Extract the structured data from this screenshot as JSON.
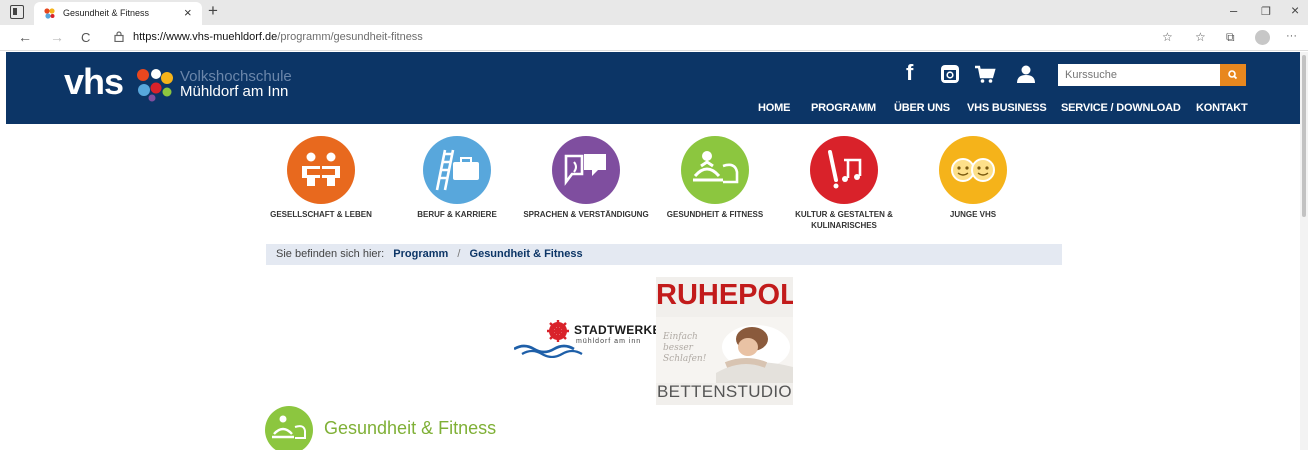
{
  "browser": {
    "tab_title": "Gesundheit & Fitness",
    "tab_close": "×",
    "new_tab": "+",
    "url_host": "https://www.vhs-muehldorf.de",
    "url_path": "/programm/gesundheit-fitness",
    "nav": {
      "back": "←",
      "forward": "→",
      "reload": "C"
    },
    "window": {
      "minimize": "–",
      "restore": "❐",
      "close": "×"
    },
    "tools": {
      "favorites_add": "☆",
      "favorites": "☆",
      "collections": "⧉",
      "more": "···"
    }
  },
  "header": {
    "logo_vhs": "vhs",
    "logo_line1": "Volkshochschule",
    "logo_line2": "Mühldorf am Inn",
    "social": {
      "facebook": "f"
    },
    "search_placeholder": "Kurssuche",
    "nav": [
      {
        "label": "HOME"
      },
      {
        "label": "PROGRAMM"
      },
      {
        "label": "ÜBER UNS"
      },
      {
        "label": "VHS BUSINESS"
      },
      {
        "label": "SERVICE / DOWNLOAD"
      },
      {
        "label": "KONTAKT"
      }
    ],
    "colors": {
      "header_bg": "#0c3566",
      "search_button": "#e8871e"
    }
  },
  "categories": [
    {
      "label": "GESELLSCHAFT & LEBEN",
      "color": "#e8691e",
      "icon": "people-icon"
    },
    {
      "label": "BERUF & KARRIERE",
      "color": "#58a7dc",
      "icon": "briefcase-ladder-icon"
    },
    {
      "label": "SPRACHEN & VERSTÄNDIGUNG",
      "color": "#7f4e9f",
      "icon": "speech-bubbles-icon"
    },
    {
      "label": "GESUNDHEIT & FITNESS",
      "color": "#8cc63f",
      "icon": "yoga-icon"
    },
    {
      "label": "KULTUR & GESTALTEN & KULINARISCHES",
      "color": "#d9222a",
      "icon": "music-note-icon"
    },
    {
      "label": "JUNGE VHS",
      "color": "#f5b31a",
      "icon": "kids-faces-icon"
    }
  ],
  "breadcrumb": {
    "prefix": "Sie befinden sich hier:",
    "items": [
      {
        "label": "Programm"
      },
      {
        "label": "Gesundheit & Fitness"
      }
    ],
    "separator": "/"
  },
  "sponsors": {
    "stadtwerke_name": "STADTWERKE",
    "stadtwerke_sub": "mühldorf am inn",
    "ruhepol_title": "RUHEPOL",
    "ruhepol_tagline": "Einfach besser Schlafen!",
    "ruhepol_sub": "BETTENSTUDIO"
  },
  "section": {
    "title": "Gesundheit & Fitness",
    "color": "#7fb036"
  }
}
